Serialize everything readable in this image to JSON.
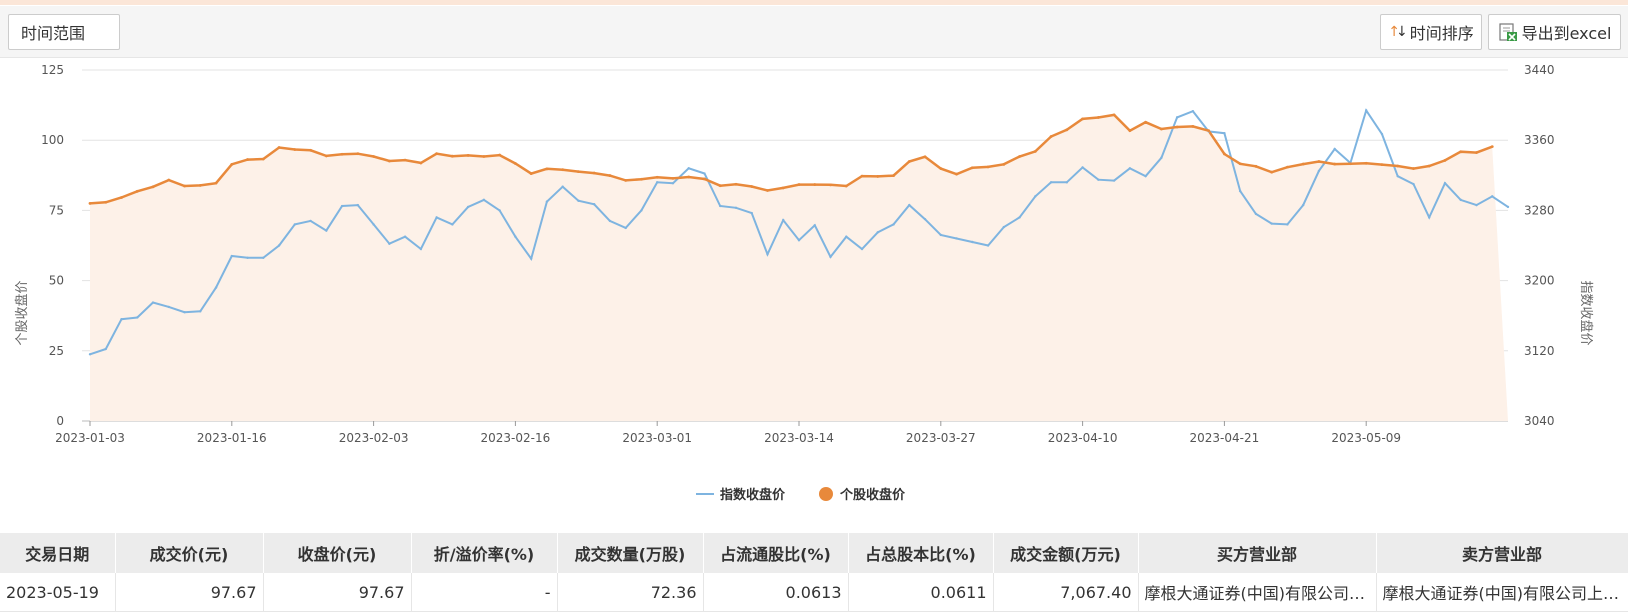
{
  "toolbar": {
    "range_label": "时间范围",
    "sort_label": "时间排序",
    "export_label": "导出到excel",
    "sort_icon": "sort-arrows-icon",
    "export_icon": "excel-icon"
  },
  "chart_data": {
    "type": "line",
    "ylabel_left": "个股收盘价",
    "ylabel_right": "指数收盘价",
    "ylim_left": [
      0,
      125
    ],
    "ylim_right": [
      3040,
      3440
    ],
    "yticks_left": [
      "0",
      "25",
      "50",
      "75",
      "100",
      "125"
    ],
    "yticks_right": [
      "3040",
      "3120",
      "3200",
      "3280",
      "3360",
      "3440"
    ],
    "xticks": [
      {
        "index": 0,
        "label": "2023-01-03"
      },
      {
        "index": 9,
        "label": "2023-01-16"
      },
      {
        "index": 18,
        "label": "2023-02-03"
      },
      {
        "index": 27,
        "label": "2023-02-16"
      },
      {
        "index": 36,
        "label": "2023-03-01"
      },
      {
        "index": 45,
        "label": "2023-03-14"
      },
      {
        "index": 54,
        "label": "2023-03-27"
      },
      {
        "index": 63,
        "label": "2023-04-10"
      },
      {
        "index": 72,
        "label": "2023-04-21"
      },
      {
        "index": 81,
        "label": "2023-05-09"
      }
    ],
    "grid": true,
    "legend_position": "bottom-center",
    "series": [
      {
        "name": "指数收盘价",
        "axis": "right",
        "color": "#7eb4e0",
        "values": [
          3116,
          3122,
          3156,
          3158,
          3175,
          3170,
          3164,
          3165,
          3192,
          3228,
          3226,
          3226,
          3240,
          3264,
          3268,
          3257,
          3285,
          3286,
          3264,
          3242,
          3250,
          3236,
          3272,
          3264,
          3284,
          3292,
          3280,
          3250,
          3225,
          3290,
          3307,
          3291,
          3287,
          3268,
          3260,
          3280,
          3312,
          3311,
          3328,
          3322,
          3285,
          3283,
          3277,
          3230,
          3269,
          3246,
          3263,
          3227,
          3250,
          3236,
          3255,
          3264,
          3286,
          3270,
          3252,
          3248,
          3244,
          3240,
          3261,
          3272,
          3296,
          3312,
          3312,
          3329,
          3315,
          3314,
          3328,
          3319,
          3340,
          3386,
          3393,
          3370,
          3368,
          3302,
          3276,
          3265,
          3264,
          3286,
          3325,
          3350,
          3334,
          3394,
          3367,
          3319,
          3310,
          3272,
          3311,
          3292,
          3286,
          3296,
          3284
        ]
      },
      {
        "name": "个股收盘价",
        "axis": "left",
        "color": "#e8893b",
        "values": [
          77.5,
          77.9,
          79.6,
          81.8,
          83.4,
          85.8,
          83.7,
          83.9,
          84.7,
          91.4,
          93.1,
          93.3,
          97.4,
          96.7,
          96.4,
          94.4,
          95.0,
          95.2,
          94.2,
          92.6,
          92.9,
          91.9,
          95.2,
          94.3,
          94.6,
          94.2,
          94.7,
          91.7,
          88.1,
          89.8,
          89.5,
          88.8,
          88.3,
          87.4,
          85.7,
          86.1,
          86.8,
          86.4,
          86.9,
          86.2,
          83.8,
          84.3,
          83.5,
          82.1,
          83.0,
          84.2,
          84.2,
          84.1,
          83.7,
          87.2,
          87.1,
          87.4,
          92.4,
          94.1,
          89.9,
          87.9,
          90.2,
          90.5,
          91.4,
          94.2,
          96.0,
          101.3,
          103.7,
          107.6,
          108.1,
          109.0,
          103.4,
          106.4,
          104.0,
          104.7,
          104.9,
          103.4,
          95.1,
          91.6,
          90.7,
          88.6,
          90.4,
          91.5,
          92.4,
          91.5,
          91.6,
          91.8,
          91.3,
          90.8,
          89.9,
          90.8,
          92.8,
          95.9,
          95.6,
          97.7
        ]
      }
    ]
  },
  "table": {
    "headers": [
      "交易日期",
      "成交价(元)",
      "收盘价(元)",
      "折/溢价率(%)",
      "成交数量(万股)",
      "占流通股比(%)",
      "占总股本比(%)",
      "成交金额(万元)",
      "买方营业部",
      "卖方营业部"
    ],
    "rows": [
      [
        "2023-05-19",
        "97.67",
        "97.67",
        "-",
        "72.36",
        "0.0613",
        "0.0611",
        "7,067.40",
        "摩根大通证券(中国)有限公司上海银城中路证券营业部",
        "摩根大通证券(中国)有限公司上海银城中路证券营业部"
      ]
    ]
  }
}
